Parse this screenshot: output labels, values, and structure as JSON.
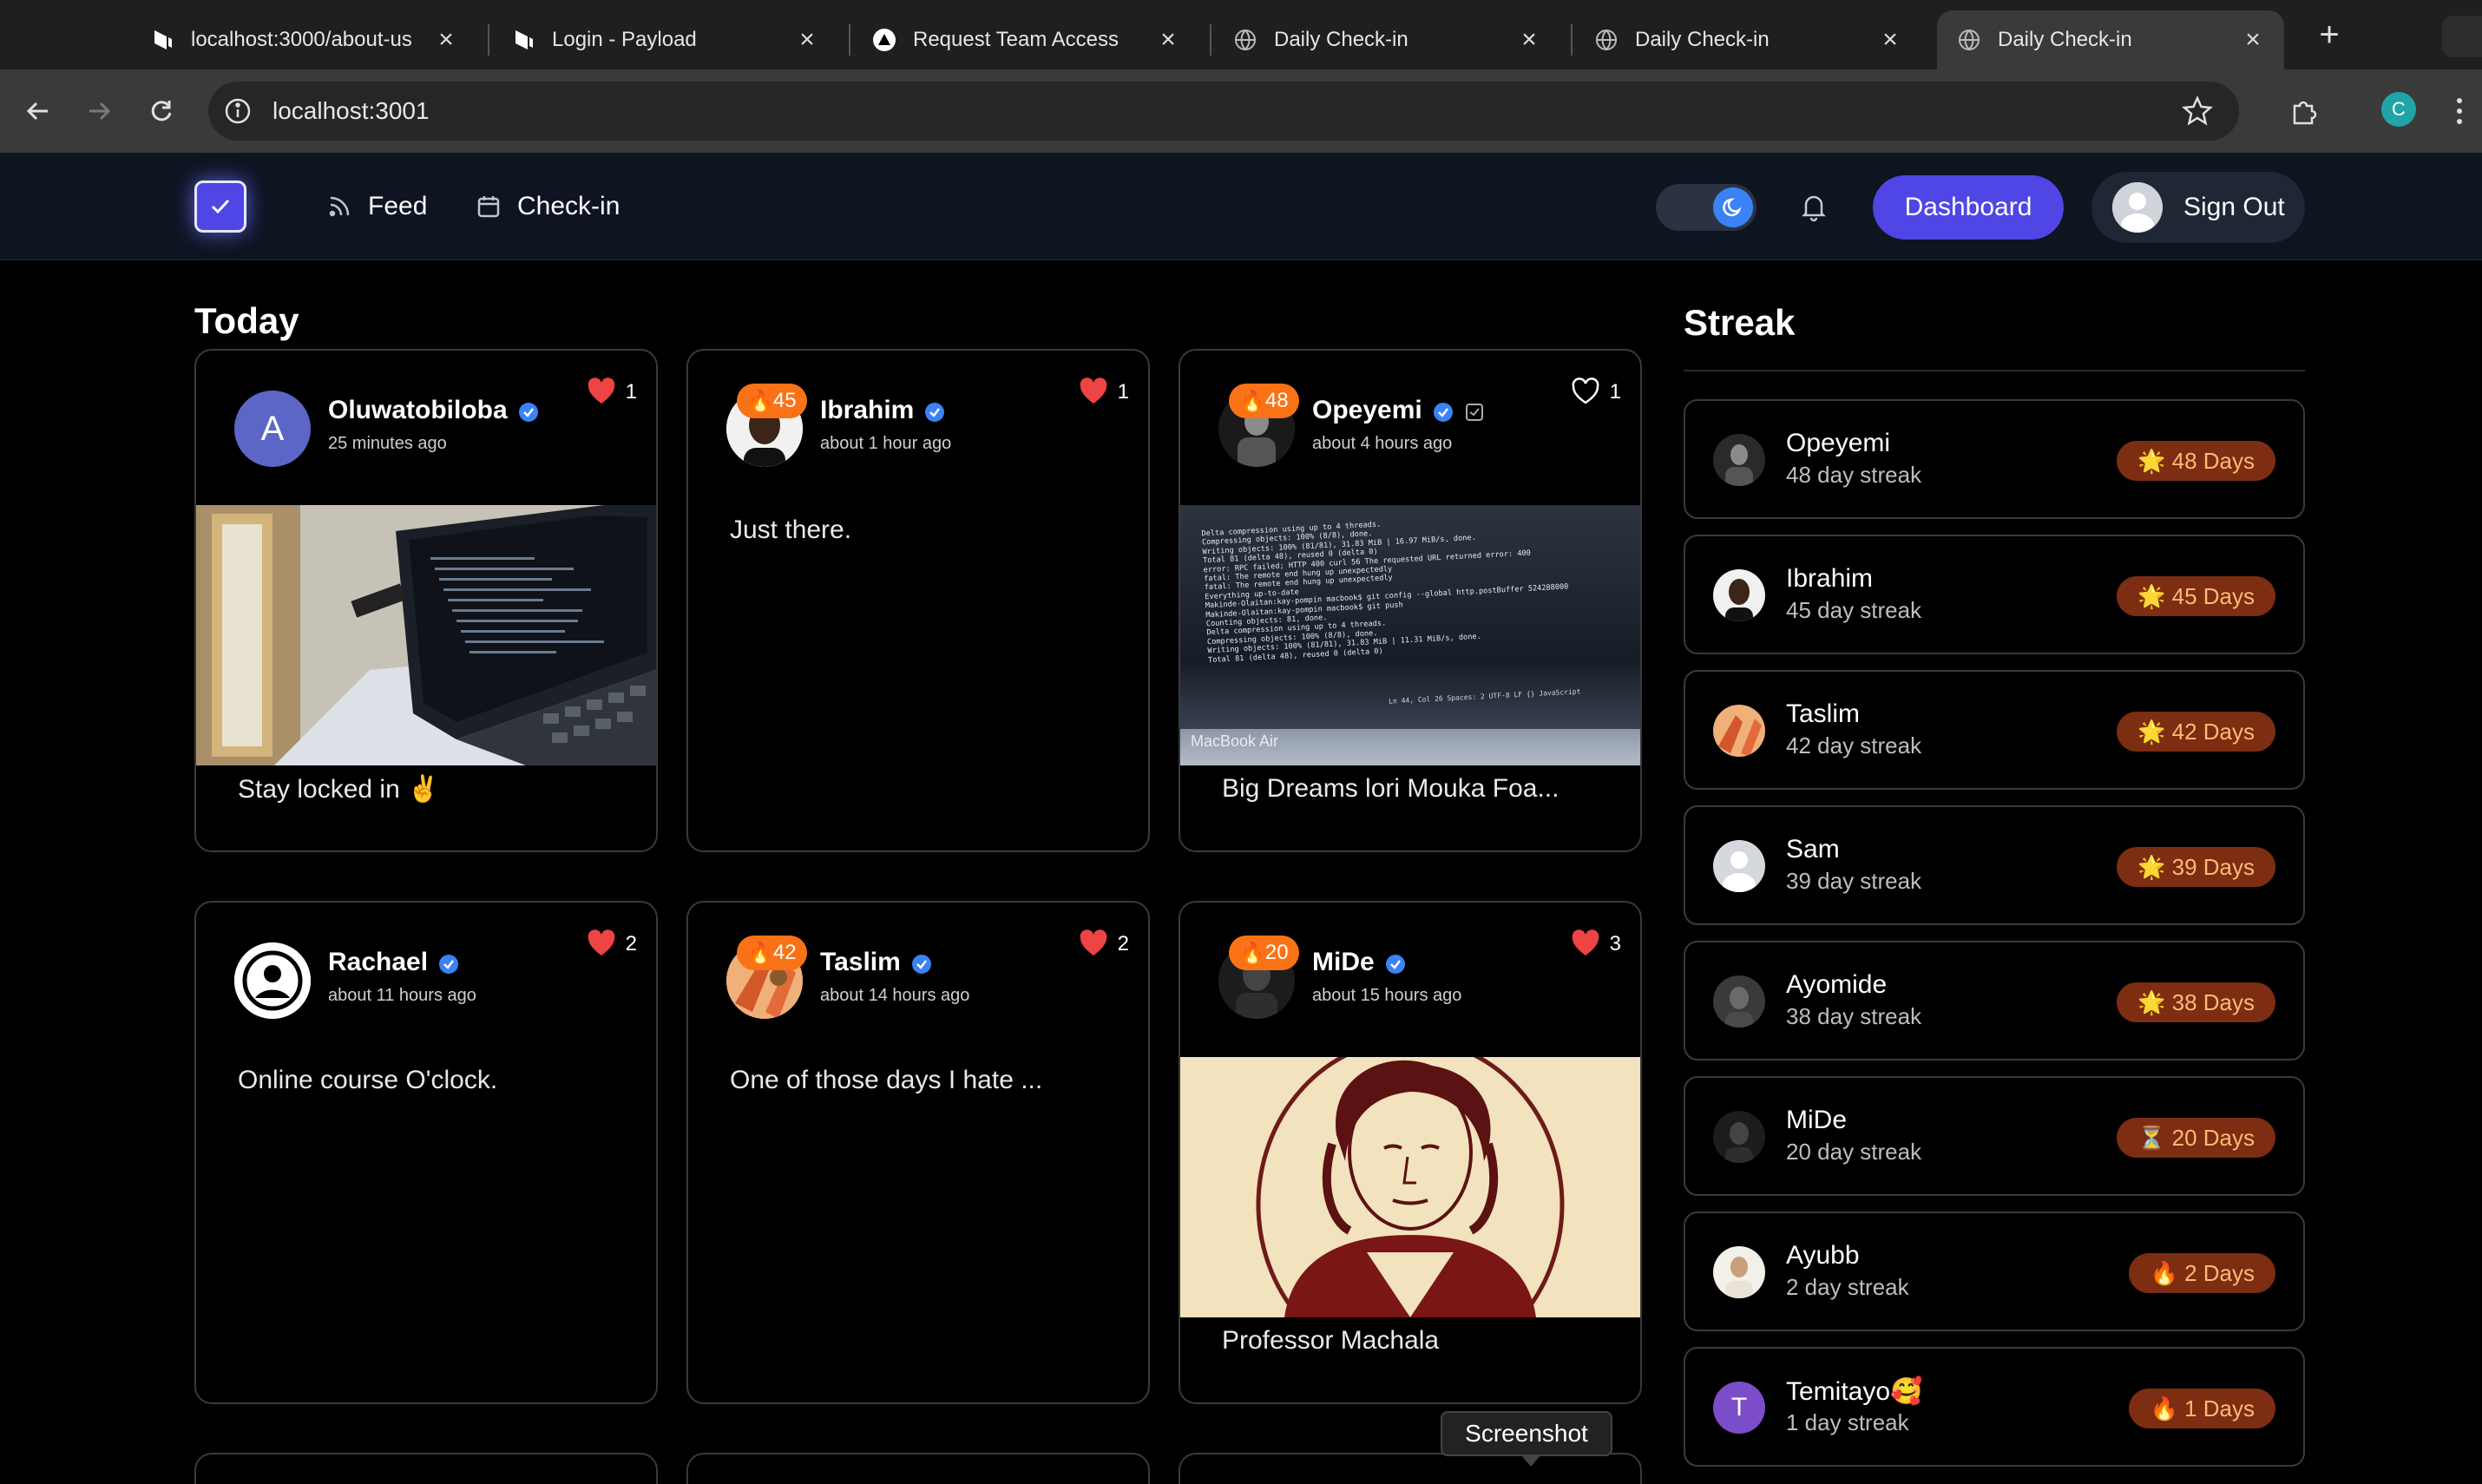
{
  "browser": {
    "tabs": [
      {
        "title": "localhost:3000/about-us",
        "icon": "payload-logo-icon",
        "active": false
      },
      {
        "title": "Login - Payload",
        "icon": "payload-logo-icon",
        "active": false
      },
      {
        "title": "Request Team Access",
        "icon": "vercel-triangle-icon",
        "active": false
      },
      {
        "title": "Daily Check-in",
        "icon": "globe-icon",
        "active": false
      },
      {
        "title": "Daily Check-in",
        "icon": "globe-icon",
        "active": false
      },
      {
        "title": "Daily Check-in",
        "icon": "globe-icon",
        "active": true
      }
    ],
    "url": "localhost:3001",
    "profile_initial": "C"
  },
  "nav": {
    "feed_label": "Feed",
    "checkin_label": "Check-in",
    "dashboard_label": "Dashboard",
    "signout_label": "Sign Out"
  },
  "feed": {
    "title": "Today",
    "posts": [
      {
        "name": "Oluwatobiloba",
        "time": "25 minutes ago",
        "likes": "1",
        "liked": true,
        "caption": "Stay locked in ✌️",
        "streak_badge": "",
        "avatar_initial": "A",
        "has_image": true
      },
      {
        "name": "Ibrahim",
        "time": "about 1 hour ago",
        "likes": "1",
        "liked": true,
        "caption": "Just there.",
        "streak_badge": "45",
        "has_image": false
      },
      {
        "name": "Opeyemi",
        "time": "about 4 hours ago",
        "likes": "1",
        "liked": false,
        "caption": "Big Dreams lori Mouka Foa...",
        "streak_badge": "48",
        "has_image": true
      },
      {
        "name": "Rachael",
        "time": "about 11 hours ago",
        "likes": "2",
        "liked": true,
        "caption": "Online course O'clock.",
        "streak_badge": "",
        "has_image": false
      },
      {
        "name": "Taslim",
        "time": "about 14 hours ago",
        "likes": "2",
        "liked": true,
        "caption": "One of those days I hate ...",
        "streak_badge": "42",
        "has_image": false
      },
      {
        "name": "MiDe",
        "time": "about 15 hours ago",
        "likes": "3",
        "liked": true,
        "caption": "Professor Machala",
        "streak_badge": "20",
        "has_image": true
      }
    ],
    "terminal_lines": [
      "Delta compression using up to 4 threads.",
      "Compressing objects: 100% (8/8), done.",
      "Writing objects: 100% (81/81), 31.83 MiB | 16.97 MiB/s, done.",
      "Total 81 (delta 48), reused 0 (delta 0)",
      "error: RPC failed; HTTP 400 curl 56 The requested URL returned error: 400",
      "fatal: The remote end hung up unexpectedly",
      "fatal: The remote end hung up unexpectedly",
      "Everything up-to-date",
      "Makinde-Olaitan:kay-pompin macbook$ git config --global http.postBuffer 524288000",
      "Makinde-Olaitan:kay-pompin macbook$ git push",
      "Counting objects: 81, done.",
      "Delta compression using up to 4 threads.",
      "Compressing objects: 100% (8/8), done.",
      "Writing objects: 100% (81/81), 31.83 MiB | 11.31 MiB/s, done.",
      "Total 81 (delta 48), reused 0 (delta 0)"
    ],
    "terminal_status": "Ln 44, Col 26   Spaces: 2   UTF-8   LF   {} JavaScript",
    "laptop_label": "MacBook Air"
  },
  "streak": {
    "title": "Streak",
    "rows": [
      {
        "name": "Opeyemi",
        "desc": "48 day streak",
        "badge": "48 Days",
        "emoji": "🌟"
      },
      {
        "name": "Ibrahim",
        "desc": "45 day streak",
        "badge": "45 Days",
        "emoji": "🌟"
      },
      {
        "name": "Taslim",
        "desc": "42 day streak",
        "badge": "42 Days",
        "emoji": "🌟"
      },
      {
        "name": "Sam",
        "desc": "39 day streak",
        "badge": "39 Days",
        "emoji": "🌟"
      },
      {
        "name": "Ayomide",
        "desc": "38 day streak",
        "badge": "38 Days",
        "emoji": "🌟"
      },
      {
        "name": "MiDe",
        "desc": "20 day streak",
        "badge": "20 Days",
        "emoji": "⏳"
      },
      {
        "name": "Ayubb",
        "desc": "2 day streak",
        "badge": "2 Days",
        "emoji": "🔥"
      },
      {
        "name": "Temitayo🥰",
        "desc": "1 day streak",
        "badge": "1 Days",
        "emoji": "🔥",
        "avatar_initial": "T"
      }
    ]
  },
  "tooltip": "Screenshot",
  "colors": {
    "accent": "#4f46e5",
    "badge_orange": "#f97316",
    "streak_badge_bg": "#7c2d12",
    "heart": "#ef4444",
    "verified": "#3b82f6"
  }
}
